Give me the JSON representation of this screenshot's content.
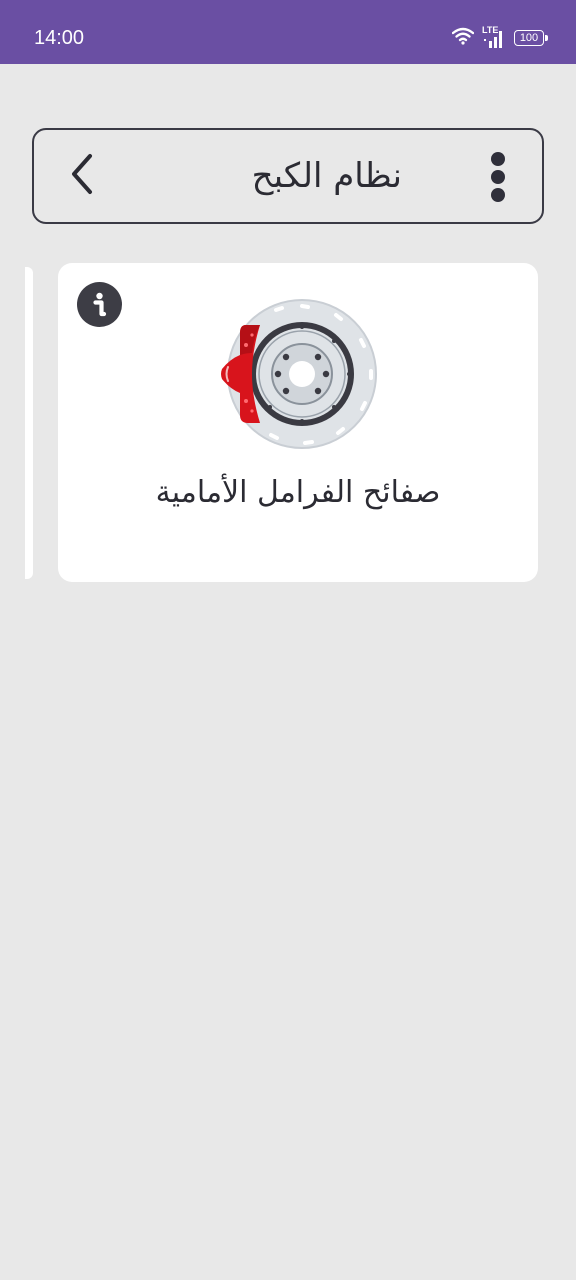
{
  "status_bar": {
    "time": "14:00",
    "network": "LTE",
    "battery": "100",
    "icons": [
      "wifi-icon",
      "signal-icon",
      "battery-icon"
    ],
    "background_color": "#6a4fa3"
  },
  "header": {
    "title": "نظام الكبح",
    "back_icon": "chevron-left-icon",
    "menu_icon": "more-vertical-icon"
  },
  "cards": [
    {
      "label": "صفائح الفرامل الأمامية",
      "image": "brake-disc-icon",
      "info_icon": "info-icon"
    }
  ],
  "colors": {
    "background": "#e8e8e8",
    "card": "#ffffff",
    "text": "#2b2b33",
    "caliper_red": "#d8141c"
  }
}
